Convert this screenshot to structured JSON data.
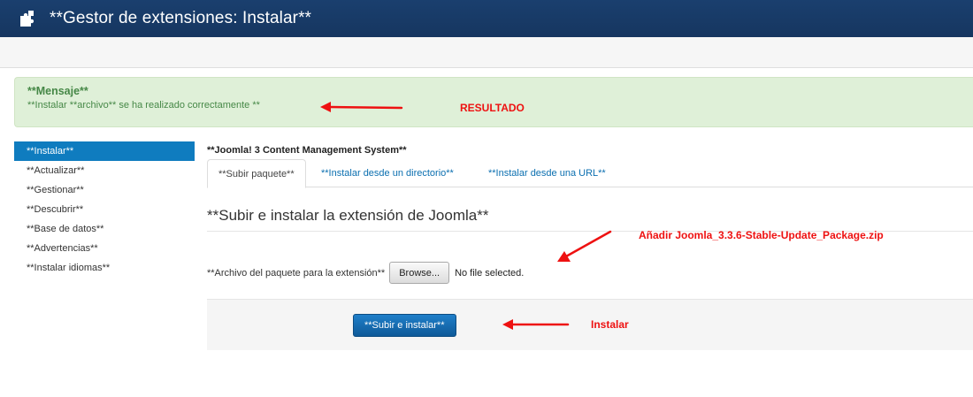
{
  "header": {
    "title": "**Gestor de extensiones: Instalar**",
    "icon": "puzzle-icon"
  },
  "alert": {
    "heading": "**Mensaje**",
    "message": "**Instalar **archivo** se ha realizado correctamente **"
  },
  "sidebar": {
    "items": [
      {
        "label": "**Instalar**",
        "active": true
      },
      {
        "label": "**Actualizar**"
      },
      {
        "label": "**Gestionar**"
      },
      {
        "label": "**Descubrir**"
      },
      {
        "label": "**Base de datos**"
      },
      {
        "label": "**Advertencias**"
      },
      {
        "label": "**Instalar idiomas**"
      }
    ]
  },
  "main": {
    "system_title": "**Joomla! 3 Content Management System**",
    "tabs": [
      {
        "label": "**Subir paquete**",
        "active": true
      },
      {
        "label": "**Instalar desde un directorio**"
      },
      {
        "label": "**Instalar desde una URL**"
      }
    ],
    "section_title": "**Subir e instalar la extensión de Joomla**",
    "file_label": "**Archivo del paquete para la extensión**",
    "browse_label": "Browse...",
    "no_file_text": "No file selected.",
    "submit_label": "**Subir e instalar**"
  },
  "annotations": {
    "resultado": "RESULTADO",
    "anadir": "Añadir Joomla_3.3.6-Stable-Update_Package.zip",
    "instalar": "Instalar"
  },
  "colors": {
    "header_bg": "#163660",
    "alert_bg": "#dff0d8",
    "alert_text": "#468847",
    "sidebar_active": "#0f7cbf",
    "link": "#0b6fb0",
    "primary_button": "#1468ad",
    "annotation": "#ee1111"
  }
}
